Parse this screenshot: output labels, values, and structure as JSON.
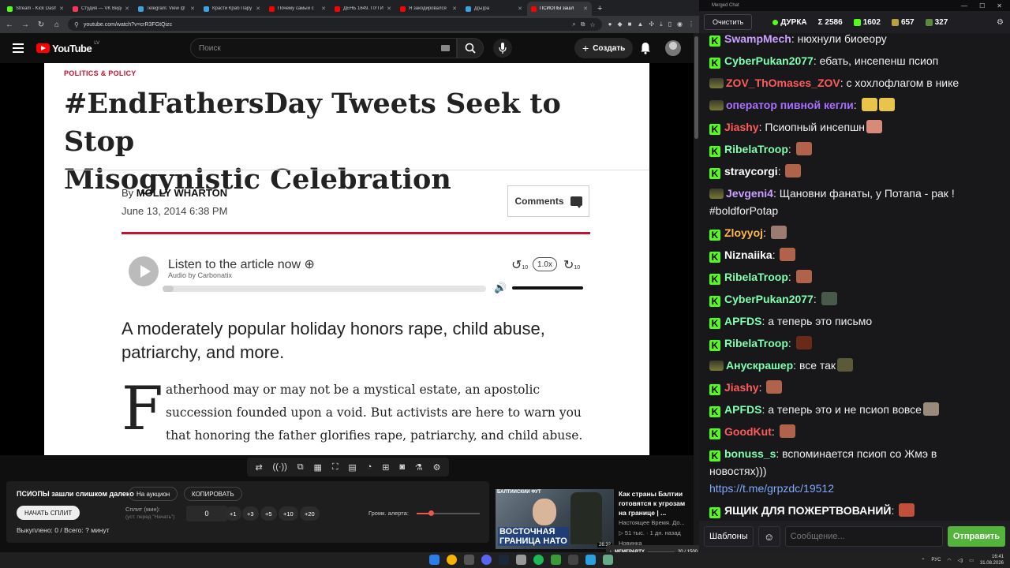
{
  "browser": {
    "tabs": [
      {
        "label": "Stream - Kick Dash",
        "color": "#53fc18"
      },
      {
        "label": "Студия — VK Видео",
        "color": "#ff3355"
      },
      {
        "label": "Telegram: View @",
        "color": "#3aa3e3"
      },
      {
        "label": "Красти Краб Пару",
        "color": "#3aa3e3"
      },
      {
        "label": "Почему самый с",
        "color": "#ff0000"
      },
      {
        "label": "ДЕНЬ 1649. ПУТИ",
        "color": "#ff0000"
      },
      {
        "label": "Я закодировался",
        "color": "#ff0000"
      },
      {
        "label": "Д(ы)ра",
        "color": "#3aa3e3"
      },
      {
        "label": "ПСИОПЫ зашл",
        "color": "#ff0000",
        "active": true
      }
    ],
    "url": "youtube.com/watch?v=crR3FGtQizc"
  },
  "youtube": {
    "logo_text": "YouTube",
    "country": "LV",
    "search_placeholder": "Поиск",
    "create_label": "Создать"
  },
  "article": {
    "section": "POLITICS & POLICY",
    "headline_line1": "#EndFathersDay Tweets Seek to Stop",
    "headline_line2": "Misogynistic Celebration",
    "by": "By",
    "author": "MOLLY WHARTON",
    "date": "June 13, 2014 6:38 PM",
    "comments": "Comments",
    "listen": "Listen to the article now",
    "audio_by": "Audio by Carbonatix",
    "speed": "1.0x",
    "rewind": "10",
    "forward": "10",
    "dek_line1": "A moderately popular holiday honors rape, child abuse,",
    "dek_line2": "patriarchy, and more.",
    "dropcap": "F",
    "body_line1": "atherhood may or may not be a mystical estate, an apostolic",
    "body_line2": "succession founded upon a void. But activists are here to warn you",
    "body_line3": "that honoring the father glorifies rape, patriarchy, and child abuse."
  },
  "split": {
    "title": "ПСИОПЫ зашли слишком далеко",
    "auction": "На аукцион",
    "copy": "КОПИРОВАТЬ",
    "start": "НАЧАТЬ СПЛИТ",
    "split_label": "Сплит (мин):",
    "split_hint": "(уст. перед \"Начать\")",
    "minutes": "0",
    "plus": [
      "+1",
      "+3",
      "+5",
      "+10",
      "+20"
    ],
    "status": "Выкуплено: 0 / Всего: ? минут",
    "alert_label": "Громк. алерта:",
    "alert_volume_fraction": 0.22
  },
  "recommendation": {
    "thumb_top": "БАЛТИЙСКИЙ ФУТ",
    "thumb_caption1": "ВОСТОЧНАЯ",
    "thumb_caption2": "ГРАНИЦА НАТО",
    "duration": "26:32",
    "title": "Как страны Балтии готовятся к угрозам на границе | ...",
    "channel": "Настоящее Время. До...",
    "meta": "▷ 51 тыс. · 1 дн. назад",
    "more": "Новинка"
  },
  "nowplaying": {
    "title": "MEMEPARTY",
    "time": "20 / 1500"
  },
  "chat": {
    "window_title": "Merged Chat",
    "clear": "Очистить",
    "channel": "ДУРКА",
    "total": "Σ 2586",
    "kick": "1602",
    "tw": "657",
    "other": "327",
    "messages": [
      {
        "user": "SwampMech",
        "color": "#c9a0ff",
        "platform": "kick",
        "text": "нюхнули биоеору"
      },
      {
        "user": "CyberPukan2077",
        "color": "#7fffb0",
        "platform": "kick",
        "text": "ебать, инсепенш псиоп"
      },
      {
        "user": "ZOV_ThOmases_ZOV",
        "color": "#ff5b5b",
        "platform": "other",
        "text": "с хохлофлагом в нике"
      },
      {
        "user": "оператор пивной кегли",
        "color": "#a970ff",
        "platform": "other",
        "text": "",
        "emotes": [
          "#e8c44a",
          "#e8c44a"
        ]
      },
      {
        "user": "Jiashy",
        "color": "#ff5b5b",
        "platform": "kick",
        "text": "Псиопный инсепшн",
        "emotes": [
          "#d88a7a"
        ]
      },
      {
        "user": "RibelaTroop",
        "color": "#7fffb0",
        "platform": "kick",
        "text": "",
        "emotes": [
          "#b0634a"
        ]
      },
      {
        "user": "straycorgi",
        "color": "#ffffff",
        "platform": "kick",
        "text": "",
        "emotes": [
          "#b0634a"
        ]
      },
      {
        "user": "Jevgeni4",
        "color": "#c9a0ff",
        "platform": "other",
        "text": "Щановни фанаты, у Потапа - рак ! #boldforPotap"
      },
      {
        "user": "Zloyyoj",
        "color": "#ffb84a",
        "platform": "kick",
        "text": "",
        "emotes": [
          "#9c7b70"
        ]
      },
      {
        "user": "Niznaiika",
        "color": "#ffffff",
        "platform": "kick",
        "text": "",
        "emotes": [
          "#b0634a"
        ]
      },
      {
        "user": "RibelaTroop",
        "color": "#7fffb0",
        "platform": "kick",
        "text": "",
        "emotes": [
          "#b0634a"
        ]
      },
      {
        "user": "CyberPukan2077",
        "color": "#7fffb0",
        "platform": "kick",
        "text": "",
        "emotes": [
          "#4a5a4a"
        ]
      },
      {
        "user": "APFDS",
        "color": "#7fffb0",
        "platform": "kick",
        "text": "а теперь это письмо"
      },
      {
        "user": "RibelaTroop",
        "color": "#7fffb0",
        "platform": "kick",
        "text": "",
        "emotes": [
          "#6a2a1a"
        ]
      },
      {
        "user": "Анускрашер",
        "color": "#7fffb0",
        "platform": "other",
        "text": "все так",
        "emotes": [
          "#5a5a3a"
        ]
      },
      {
        "user": "Jiashy",
        "color": "#ff5b5b",
        "platform": "kick",
        "text": "",
        "emotes": [
          "#b0634a"
        ]
      },
      {
        "user": "APFDS",
        "color": "#7fffb0",
        "platform": "kick",
        "text": "а теперь это и не псиоп вовсе",
        "emotes": [
          "#9a8a7a"
        ]
      },
      {
        "user": "GoodKut",
        "color": "#ff5b5b",
        "platform": "kick",
        "text": "",
        "emotes": [
          "#b0634a"
        ]
      },
      {
        "user": "bonuss_s",
        "color": "#7fffb0",
        "platform": "kick",
        "text": "вспоминается псиоп со Жмэ в новостях)))",
        "link": "https://t.me/grpzdc/19512"
      },
      {
        "user": "ЯЩИК ДЛЯ ПОЖЕРТВОВАНИЙ",
        "color": "#ffffff",
        "platform": "kick",
        "text": "",
        "emotes": [
          "#c0503a"
        ]
      }
    ],
    "templates": "Шаблоны",
    "placeholder": "Сообщение...",
    "send": "Отправить"
  },
  "taskbar": {
    "lang": "РУС",
    "time": "16:41",
    "date": "31.08.2026"
  }
}
